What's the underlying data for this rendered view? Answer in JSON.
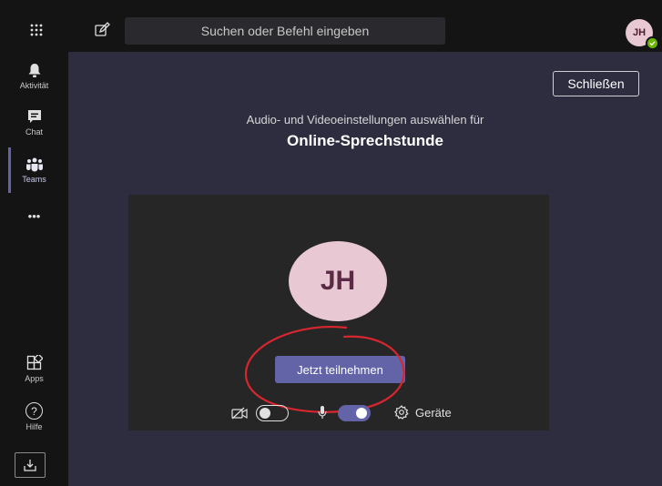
{
  "topbar": {
    "search_placeholder": "Suchen oder Befehl eingeben",
    "avatar_initials": "JH"
  },
  "sidebar": {
    "items": [
      {
        "label": "Aktivität",
        "icon": "bell-icon"
      },
      {
        "label": "Chat",
        "icon": "chat-icon"
      },
      {
        "label": "Teams",
        "icon": "teams-icon",
        "active": true
      },
      {
        "label": "",
        "icon": "more-icon"
      },
      {
        "label": "Apps",
        "icon": "apps-icon"
      },
      {
        "label": "Hilfe",
        "icon": "help-icon"
      },
      {
        "label": "",
        "icon": "download-icon"
      }
    ],
    "more_glyph": "•••",
    "help_glyph": "?"
  },
  "main": {
    "close_label": "Schließen",
    "subtitle": "Audio- und Videoeinstellungen auswählen für",
    "meeting_title": "Online-Sprechstunde",
    "avatar_initials": "JH",
    "join_label": "Jetzt teilnehmen",
    "camera_on": false,
    "mic_on": true,
    "devices_label": "Geräte"
  },
  "colors": {
    "accent": "#6264a7",
    "annotation": "#d7262e",
    "avatar": "#e8c9d3",
    "background": "#2e2d3f",
    "sidebar": "#141414"
  }
}
